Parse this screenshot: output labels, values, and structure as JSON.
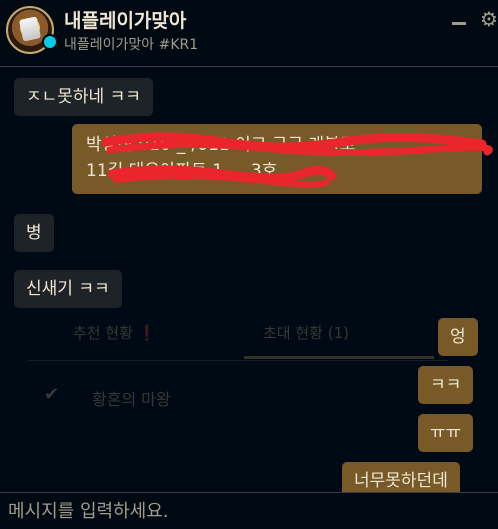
{
  "header": {
    "display_name": "내플레이가맞아",
    "riot_id": "내플레이가맞아 #KR1",
    "status_color": "#0acbe6",
    "icons": [
      "minimize-icon",
      "settings-gear-icon"
    ]
  },
  "background_panel": {
    "tab_recommend": "추천 현황 ❗",
    "tab_invite": "초대 현황 (1)",
    "check_icon": "✔",
    "item": "황혼의 마왕"
  },
  "messages": [
    {
      "side": "left",
      "text": "ㅈㄴ못하네 ㅋㅋ"
    },
    {
      "side": "right",
      "lines": [
        "박성진 010-_-/011 이고 구구 개봉로",
        "11길 대우아파트 1_ _ 3호"
      ],
      "redacted": true
    },
    {
      "side": "left",
      "text": "병"
    },
    {
      "side": "left",
      "text": "신새기 ㅋㅋ"
    },
    {
      "side": "right",
      "text": "엉"
    },
    {
      "side": "right",
      "text": "ㅋㅋ"
    },
    {
      "side": "right",
      "text": "ㅠㅠ"
    },
    {
      "side": "right",
      "text": "너무못하던데"
    }
  ],
  "input": {
    "placeholder": "메시지를 입력하세요."
  },
  "colors": {
    "accent_gold": "#785a28",
    "bubble_dark": "#1e2328",
    "redaction": "#e8262b"
  }
}
